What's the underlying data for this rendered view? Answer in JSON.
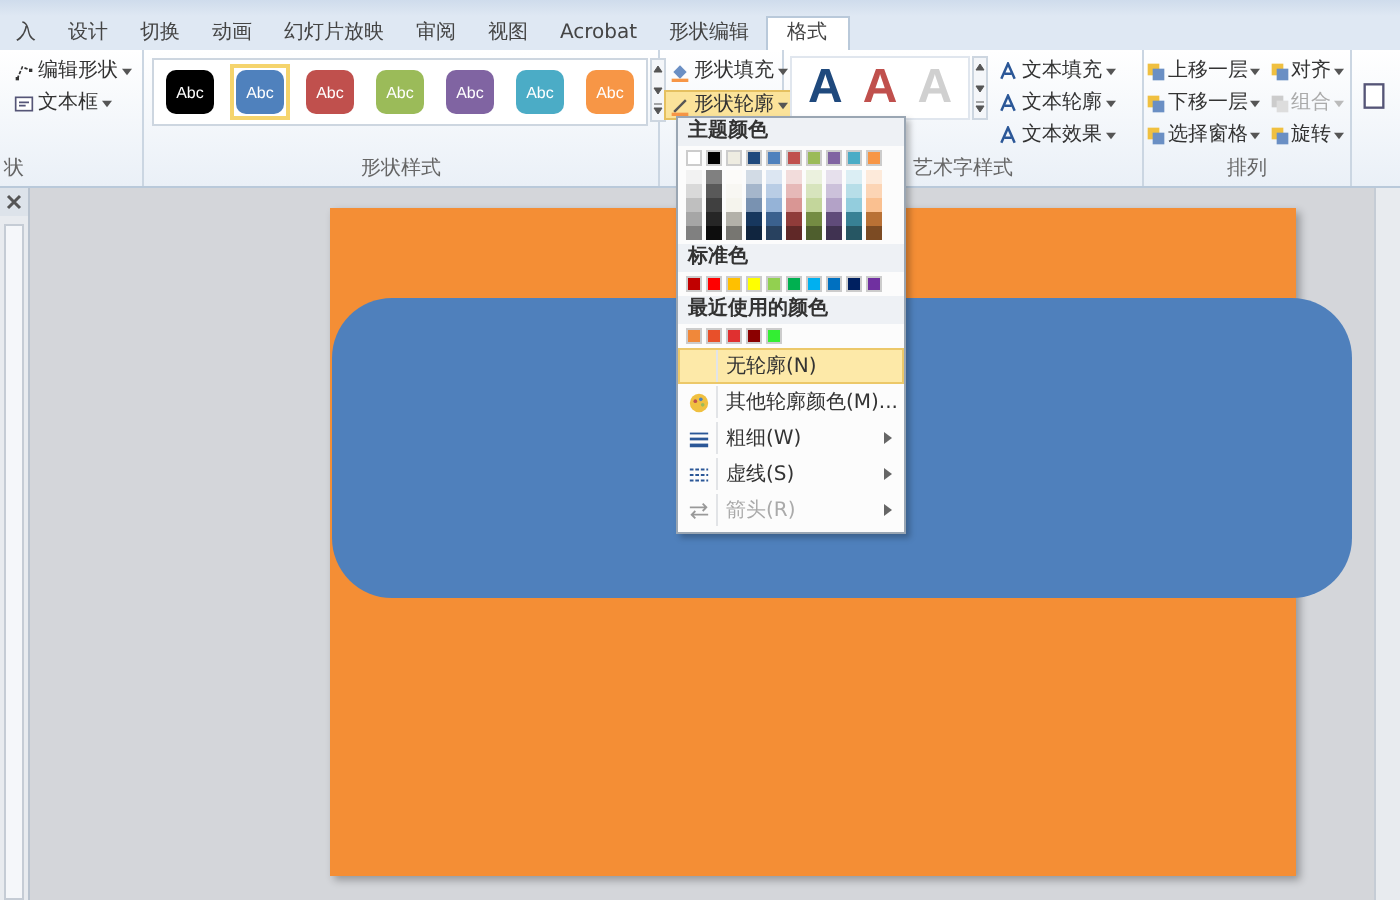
{
  "tabs": [
    {
      "label": "入",
      "selected": false
    },
    {
      "label": "设计",
      "selected": false
    },
    {
      "label": "切换",
      "selected": false
    },
    {
      "label": "动画",
      "selected": false
    },
    {
      "label": "幻灯片放映",
      "selected": false
    },
    {
      "label": "审阅",
      "selected": false
    },
    {
      "label": "视图",
      "selected": false
    },
    {
      "label": "Acrobat",
      "selected": false
    },
    {
      "label": "形状编辑",
      "selected": false
    },
    {
      "label": "格式",
      "selected": true
    }
  ],
  "insert_group": {
    "items": [
      "编辑形状",
      "文本框"
    ],
    "label": "状"
  },
  "shape_styles": {
    "label": "形状样式",
    "swatches": [
      {
        "text": "Abc",
        "color": "#000000",
        "selected": false
      },
      {
        "text": "Abc",
        "color": "#4f81bd",
        "selected": true
      },
      {
        "text": "Abc",
        "color": "#c0504d",
        "selected": false
      },
      {
        "text": "Abc",
        "color": "#9bbb59",
        "selected": false
      },
      {
        "text": "Abc",
        "color": "#8064a2",
        "selected": false
      },
      {
        "text": "Abc",
        "color": "#4bacc6",
        "selected": false
      },
      {
        "text": "Abc",
        "color": "#f79646",
        "selected": false
      }
    ]
  },
  "shape_buttons": [
    {
      "label": "形状填充",
      "selected": false
    },
    {
      "label": "形状轮廓",
      "selected": true
    }
  ],
  "wordart": {
    "label": "艺术字样式",
    "letters": [
      {
        "text": "A",
        "color": "#1f497d"
      },
      {
        "text": "A",
        "color": "#c0504d"
      },
      {
        "text": "A",
        "color": "#d0d0d0"
      }
    ],
    "buttons": [
      "文本填充",
      "文本轮廓",
      "文本效果"
    ]
  },
  "arrange": {
    "label": "排列",
    "buttons": [
      {
        "label": "上移一层",
        "disabled": false
      },
      {
        "label": "对齐",
        "disabled": false
      },
      {
        "label": "下移一层",
        "disabled": false
      },
      {
        "label": "组合",
        "disabled": true
      },
      {
        "label": "选择窗格",
        "disabled": false
      },
      {
        "label": "旋转",
        "disabled": false
      }
    ]
  },
  "outline_menu": {
    "theme_title": "主题颜色",
    "theme_colors": [
      {
        "color": "#ffffff"
      },
      {
        "color": "#000000"
      },
      {
        "color": "#eeece1"
      },
      {
        "color": "#1f497d"
      },
      {
        "color": "#4f81bd"
      },
      {
        "color": "#c0504d"
      },
      {
        "color": "#9bbb59"
      },
      {
        "color": "#8064a2"
      },
      {
        "color": "#4bacc6"
      },
      {
        "color": "#f79646"
      }
    ],
    "standard_title": "标准色",
    "standard_colors": [
      {
        "color": "#c00000"
      },
      {
        "color": "#ff0000"
      },
      {
        "color": "#ffc000"
      },
      {
        "color": "#ffff00"
      },
      {
        "color": "#92d050"
      },
      {
        "color": "#00b050"
      },
      {
        "color": "#00b0f0"
      },
      {
        "color": "#0070c0"
      },
      {
        "color": "#002060"
      },
      {
        "color": "#7030a0"
      }
    ],
    "recent_title": "最近使用的颜色",
    "recent_colors": [
      {
        "color": "#f0883a"
      },
      {
        "color": "#e8502a"
      },
      {
        "color": "#e03030"
      },
      {
        "color": "#8b0000"
      },
      {
        "color": "#33ee33"
      }
    ],
    "items": [
      {
        "label": "无轮廓(N)",
        "kind": "plain",
        "selected": true,
        "disabled": false,
        "submenu": false
      },
      {
        "label": "其他轮廓颜色(M)...",
        "kind": "palette",
        "selected": false,
        "disabled": false,
        "submenu": false
      },
      {
        "label": "粗细(W)",
        "kind": "weight",
        "selected": false,
        "disabled": false,
        "submenu": true
      },
      {
        "label": "虚线(S)",
        "kind": "dash",
        "selected": false,
        "disabled": false,
        "submenu": true
      },
      {
        "label": "箭头(R)",
        "kind": "arrow",
        "selected": false,
        "disabled": true,
        "submenu": true
      }
    ]
  }
}
